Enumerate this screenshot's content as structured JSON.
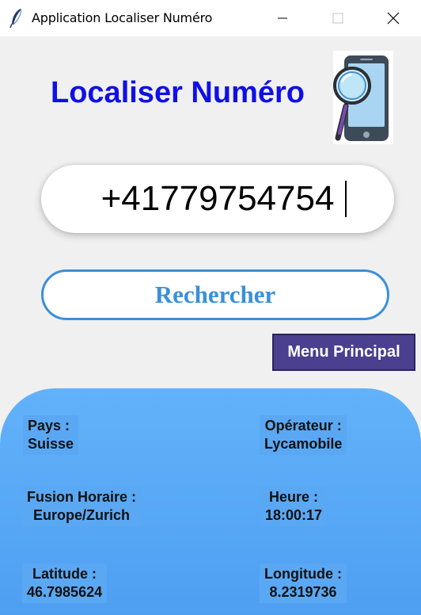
{
  "window": {
    "title": "Application Localiser Numéro",
    "controls": {
      "minimize": "minimize-icon",
      "maximize": "maximize-icon",
      "close": "close-icon"
    },
    "app_icon": "feather-icon"
  },
  "header": {
    "title": "Localiser Numéro",
    "title_color": "#1010e6",
    "logo_icon": "phone-magnifier-icon"
  },
  "search": {
    "phone_value": "+41779754754",
    "button_label": "Rechercher",
    "accent_color": "#3a8fd9"
  },
  "menu": {
    "button_label": "Menu Principal",
    "button_color": "#4b3f8f"
  },
  "results": {
    "panel_color": "#5aa8f3",
    "pays": {
      "label": "Pays :",
      "value": "Suisse"
    },
    "operateur": {
      "label": "Opérateur :",
      "value": "Lycamobile"
    },
    "fuseau": {
      "label": "Fusion Horaire :",
      "value": "Europe/Zurich"
    },
    "heure": {
      "label": "Heure :",
      "value": "18:00:17"
    },
    "latitude": {
      "label": "Latitude :",
      "value": "46.7985624"
    },
    "longitude": {
      "label": "Longitude :",
      "value": "8.2319736"
    }
  }
}
